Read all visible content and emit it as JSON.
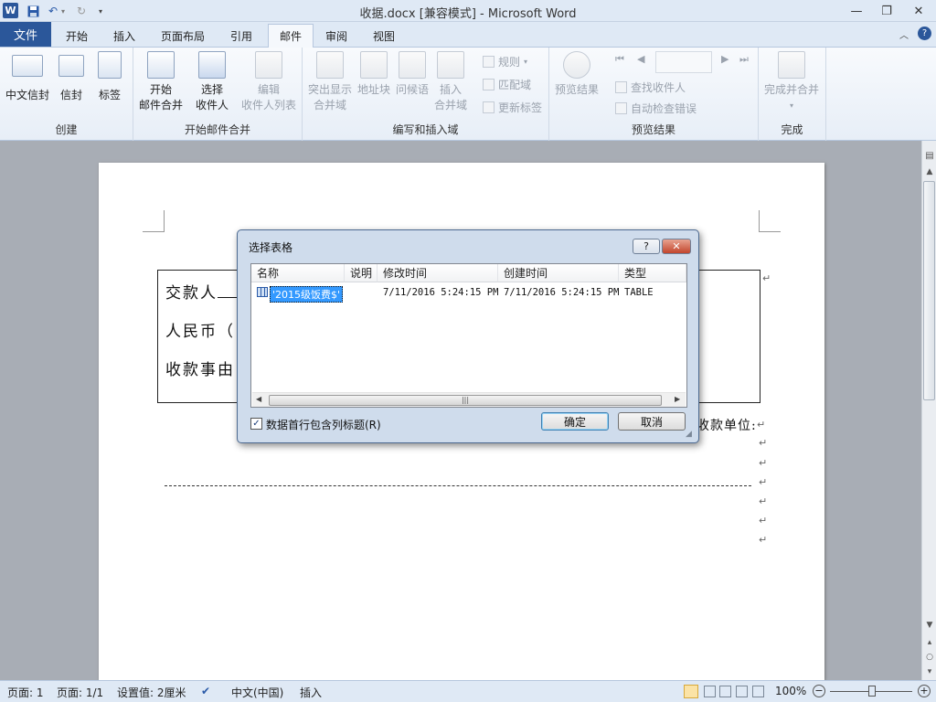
{
  "window": {
    "title": "收据.docx [兼容模式] - Microsoft Word",
    "app_icon": "W",
    "minimize": "—",
    "restore": "❐",
    "close": "✕"
  },
  "tabs": {
    "file": "文件",
    "items": [
      "开始",
      "插入",
      "页面布局",
      "引用",
      "邮件",
      "审阅",
      "视图"
    ],
    "active": "邮件"
  },
  "ribbon": {
    "groups": {
      "create": "创建",
      "start_merge": "开始邮件合并",
      "write_insert": "编写和插入域",
      "preview": "预览结果",
      "finish": "完成"
    },
    "buttons": {
      "envelope_cn": "中文信封",
      "envelope": "信封",
      "labels": "标签",
      "start_merge_1": "开始",
      "start_merge_2": "邮件合并",
      "select_recipients_1": "选择",
      "select_recipients_2": "收件人",
      "edit_list_1": "编辑",
      "edit_list_2": "收件人列表",
      "highlight_1": "突出显示",
      "highlight_2": "合并域",
      "address_block": "地址块",
      "greeting": "问候语",
      "insert_field_1": "插入",
      "insert_field_2": "合并域",
      "rules": "规则",
      "match_fields": "匹配域",
      "update_labels": "更新标签",
      "preview_results": "预览结果",
      "find_recipient": "查找收件人",
      "auto_check": "自动检查错误",
      "finish_merge": "完成并合并"
    }
  },
  "document": {
    "line1": "交款人",
    "line2": "人民币（",
    "line3": "收款事由",
    "payee_unit": "收款单位:",
    "return_mark": "↵"
  },
  "dialog": {
    "title": "选择表格",
    "help": "?",
    "close": "✕",
    "columns": [
      "名称",
      "说明",
      "修改时间",
      "创建时间",
      "类型"
    ],
    "rows": [
      {
        "name": "'2015级饭费$'",
        "desc": "",
        "modified": "7/11/2016 5:24:15 PM",
        "created": "7/11/2016 5:24:15 PM",
        "type": "TABLE",
        "selected": true
      }
    ],
    "checkbox_label": "数据首行包含列标题(R)",
    "checkbox_checked": true,
    "ok": "确定",
    "cancel": "取消"
  },
  "status": {
    "page": "页面: 1",
    "pages": "页面: 1/1",
    "setting": "设置值: 2厘米",
    "language": "中文(中国)",
    "mode": "插入",
    "zoom": "100%",
    "zoom_out": "−",
    "zoom_in": "+"
  },
  "colors": {
    "accent": "#2b579a",
    "selection": "#3399ff"
  }
}
